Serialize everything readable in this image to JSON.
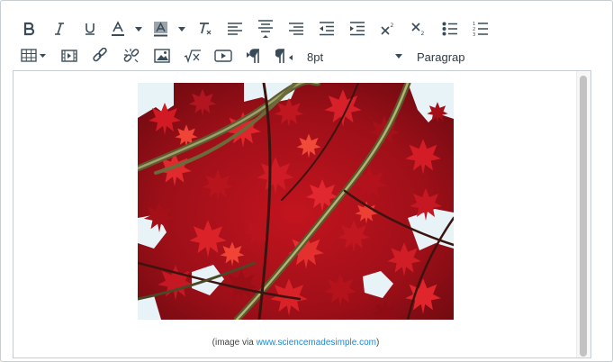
{
  "toolbar": {
    "font_size": "8pt",
    "block_format": "Paragraph",
    "icons": [
      "bold-icon",
      "italic-icon",
      "underline-icon",
      "text-color-icon",
      "background-color-icon",
      "clear-formatting-icon",
      "align-left-icon",
      "align-center-icon",
      "align-right-icon",
      "outdent-icon",
      "indent-icon",
      "superscript-icon",
      "subscript-icon",
      "bullet-list-icon",
      "numbered-list-icon",
      "table-icon",
      "media-icon",
      "link-icon",
      "unlink-icon",
      "image-icon",
      "math-equation-icon",
      "video-icon",
      "ltr-icon",
      "rtl-icon"
    ]
  },
  "content": {
    "caption_prefix": "(image via ",
    "caption_link": "www.sciencemadesimple.com",
    "caption_suffix": ")"
  },
  "colors": {
    "link": "#1b8ad1",
    "icon": "#394b58",
    "leaf_red": "#b3121c",
    "sky": "#e8f3f8"
  }
}
